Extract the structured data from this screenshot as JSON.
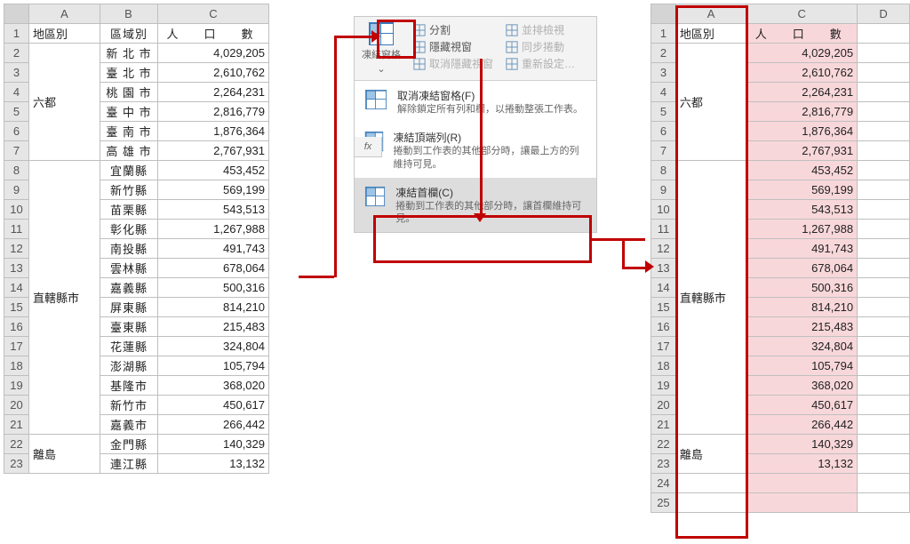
{
  "left": {
    "cols": [
      "A",
      "B",
      "C"
    ],
    "headers": {
      "A": "地區別",
      "B": "區域別",
      "C": "人　口　數"
    },
    "groups": [
      {
        "region": "六都",
        "rows": [
          {
            "b": "新 北 市",
            "c": "4,029,205"
          },
          {
            "b": "臺 北 市",
            "c": "2,610,762"
          },
          {
            "b": "桃 園 市",
            "c": "2,264,231"
          },
          {
            "b": "臺 中 市",
            "c": "2,816,779"
          },
          {
            "b": "臺 南 市",
            "c": "1,876,364"
          },
          {
            "b": "高 雄 市",
            "c": "2,767,931"
          }
        ]
      },
      {
        "region": "直轄縣市",
        "rows": [
          {
            "b": "宜蘭縣",
            "c": "453,452"
          },
          {
            "b": "新竹縣",
            "c": "569,199"
          },
          {
            "b": "苗栗縣",
            "c": "543,513"
          },
          {
            "b": "彰化縣",
            "c": "1,267,988"
          },
          {
            "b": "南投縣",
            "c": "491,743"
          },
          {
            "b": "雲林縣",
            "c": "678,064"
          },
          {
            "b": "嘉義縣",
            "c": "500,316"
          },
          {
            "b": "屏東縣",
            "c": "814,210"
          },
          {
            "b": "臺東縣",
            "c": "215,483"
          },
          {
            "b": "花蓮縣",
            "c": "324,804"
          },
          {
            "b": "澎湖縣",
            "c": "105,794"
          },
          {
            "b": "基隆市",
            "c": "368,020"
          },
          {
            "b": "新竹市",
            "c": "450,617"
          },
          {
            "b": "嘉義市",
            "c": "266,442"
          }
        ]
      },
      {
        "region": "離島",
        "rows": [
          {
            "b": "金門縣",
            "c": "140,329"
          },
          {
            "b": "連江縣",
            "c": "13,132"
          }
        ]
      }
    ]
  },
  "right": {
    "cols": [
      "A",
      "C",
      "D"
    ],
    "headers": {
      "A": "地區別",
      "C": "人　口　數"
    },
    "groups": [
      {
        "region": "六都",
        "rows": [
          "4,029,205",
          "2,610,762",
          "2,264,231",
          "2,816,779",
          "1,876,364",
          "2,767,931"
        ]
      },
      {
        "region": "直轄縣市",
        "rows": [
          "453,452",
          "569,199",
          "543,513",
          "1,267,988",
          "491,743",
          "678,064",
          "500,316",
          "814,210",
          "215,483",
          "324,804",
          "105,794",
          "368,020",
          "450,617",
          "266,442"
        ]
      },
      {
        "region": "離島",
        "rows": [
          "140,329",
          "13,132"
        ]
      }
    ],
    "selected_row": 7
  },
  "ribbon": {
    "freeze_label": "凍結窗格",
    "small": [
      {
        "icon": "split",
        "label": "分割",
        "disabled": false
      },
      {
        "icon": "hide",
        "label": "隱藏視窗",
        "disabled": false
      },
      {
        "icon": "unhide",
        "label": "取消隱藏視窗",
        "disabled": true
      },
      {
        "icon": "side",
        "label": "並排檢視",
        "disabled": true
      },
      {
        "icon": "sync",
        "label": "同步捲動",
        "disabled": true
      },
      {
        "icon": "reset",
        "label": "重新設定…",
        "disabled": true
      }
    ],
    "fx_label": "fx",
    "menu": [
      {
        "title": "取消凍結窗格(F)",
        "sub": "解除鎖定所有列和欄，以捲動整張工作表。"
      },
      {
        "title": "凍結頂端列(R)",
        "sub": "捲動到工作表的其他部分時，讓最上方的列維持可見。"
      },
      {
        "title": "凍結首欄(C)",
        "sub": "捲動到工作表的其他部分時，讓首欄維持可見。"
      }
    ]
  }
}
